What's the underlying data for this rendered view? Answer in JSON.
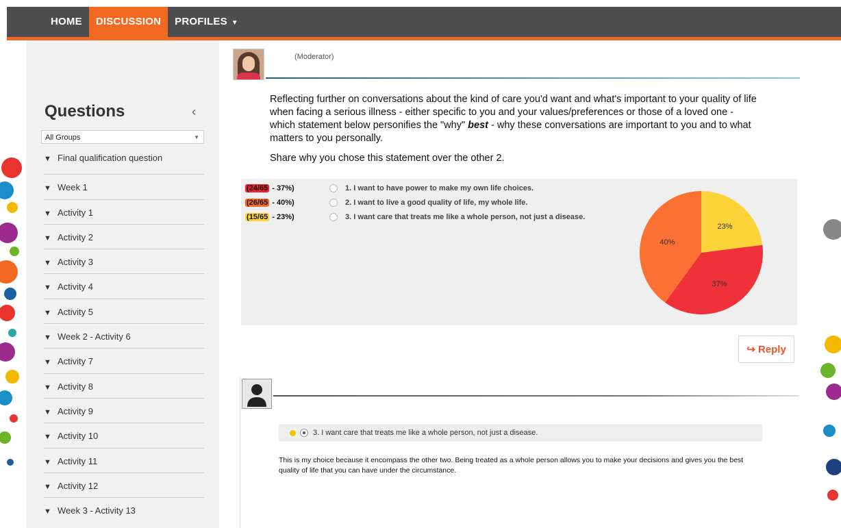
{
  "nav": {
    "items": [
      {
        "label": "HOME"
      },
      {
        "label": "DISCUSSION"
      },
      {
        "label": "PROFILES"
      }
    ],
    "active": "DISCUSSION"
  },
  "sidebar": {
    "title": "Questions",
    "collapse_icon": "chevron-left-icon",
    "group_select": {
      "value": "All Groups"
    },
    "items": [
      {
        "label": "Final qualification question"
      },
      {
        "label": "Week 1"
      },
      {
        "label": "Activity 1"
      },
      {
        "label": "Activity 2"
      },
      {
        "label": "Activity 3"
      },
      {
        "label": "Activity 4"
      },
      {
        "label": "Activity 5"
      },
      {
        "label": "Week 2 - Activity 6"
      },
      {
        "label": "Activity 7"
      },
      {
        "label": "Activity 8"
      },
      {
        "label": "Activity 9"
      },
      {
        "label": "Activity 10"
      },
      {
        "label": "Activity 11"
      },
      {
        "label": "Activity 12"
      },
      {
        "label": "Week 3 - Activity 13"
      }
    ]
  },
  "post": {
    "author_role": "(Moderator)",
    "question_lead": "Reflecting further on conversations about the kind of care you'd want and what's important to your quality of life when facing a serious illness - either specific to you and your values/preferences or those of a loved one - which statement below personifies the \"why\" ",
    "question_emphasis": "best",
    "question_tail": " - why these conversations are important to you and to what matters to you personally.",
    "question_2": "Share why you chose this statement over the other 2."
  },
  "poll": {
    "options": [
      {
        "count": "(24/65",
        "pct": " - 37%)",
        "text": "1. I want to have power to make my own life choices.",
        "color": "#e8232e"
      },
      {
        "count": "(26/65",
        "pct": " - 40%)",
        "text": "2. I want to live a good quality of life, my whole life.",
        "color": "#f26b2c"
      },
      {
        "count": "(15/65",
        "pct": " - 23%)",
        "text": "3. I want care that treats me like a whole person, not just a disease.",
        "color": "#fcd43a"
      }
    ]
  },
  "chart_data": {
    "type": "pie",
    "slices": [
      {
        "label": "23%",
        "value": 23,
        "color": "#fcd43a"
      },
      {
        "label": "37%",
        "value": 37,
        "color": "#f0313a"
      },
      {
        "label": "40%",
        "value": 40,
        "color": "#fb7133"
      }
    ]
  },
  "reply_button": {
    "label": "Reply",
    "icon": "reply-arrow-icon"
  },
  "reply": {
    "choice_text": "3. I want care that treats me like a whole person, not just a disease.",
    "body": "This is my choice because it encompass the other two. Being treated as a whole person allows you to make your decisions and gives you the best quality of life that you can have under the circumstance."
  }
}
